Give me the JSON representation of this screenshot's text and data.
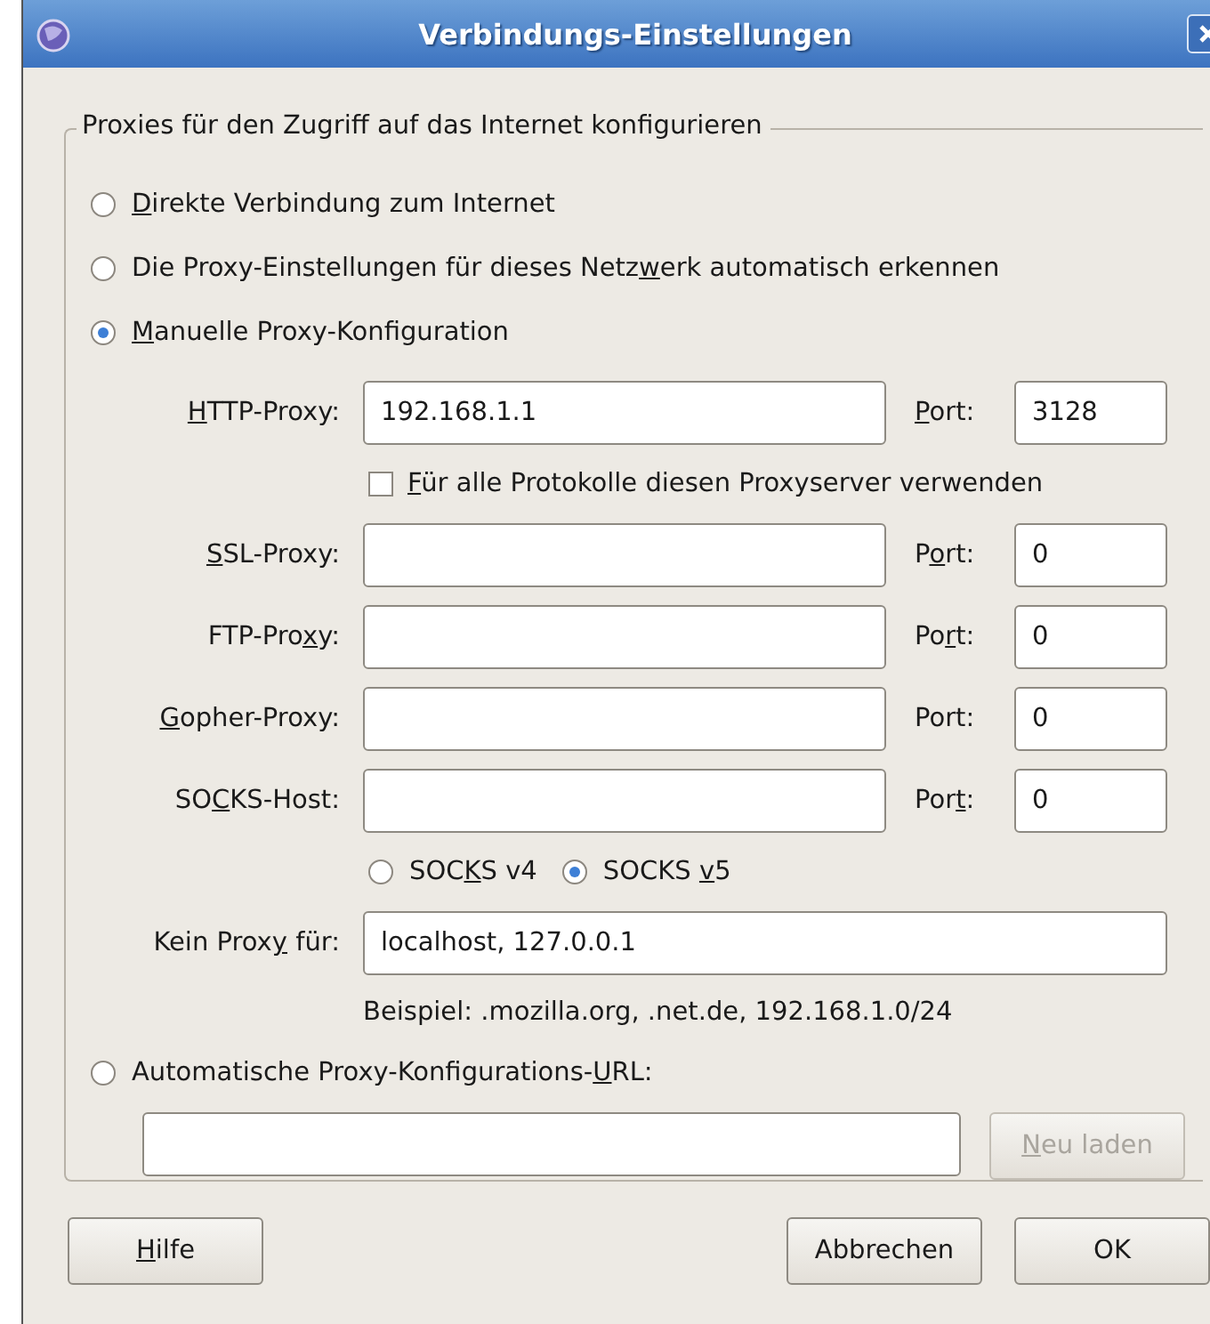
{
  "window": {
    "title": "Verbindungs-Einstellungen"
  },
  "group": {
    "legend": "Proxies für den Zugriff auf das Internet konfigurieren"
  },
  "modes": [
    {
      "label": {
        "key": "D",
        "post": "irekte Verbindung zum Internet"
      },
      "selected": false
    },
    {
      "label": {
        "pre": "Die Proxy-Einstellungen für dieses Netz",
        "key": "w",
        "post": "erk automatisch erkennen"
      },
      "selected": false
    },
    {
      "label": {
        "key": "M",
        "post": "anuelle Proxy-Konfiguration"
      },
      "selected": true
    }
  ],
  "http": {
    "label": {
      "key": "H",
      "post": "TTP-Proxy:"
    },
    "host": "192.168.1.1",
    "port_label": {
      "key": "P",
      "post": "ort:"
    },
    "port": "3128"
  },
  "use_for_all": {
    "label": {
      "key": "F",
      "post": "ür alle Protokolle diesen Proxyserver verwenden"
    },
    "checked": false
  },
  "proxies": [
    {
      "label": {
        "key": "S",
        "post": "SL-Proxy:"
      },
      "port_label": {
        "pre": "P",
        "key": "o",
        "post": "rt:"
      },
      "port": "0"
    },
    {
      "label": {
        "pre": "FTP-Pro",
        "key": "x",
        "post": "y:"
      },
      "port_label": {
        "pre": "Po",
        "key": "r",
        "post": "t:"
      },
      "port": "0"
    },
    {
      "label": {
        "key": "G",
        "post": "opher-Proxy:"
      },
      "port_label": {
        "pre": "Port:"
      },
      "port": "0"
    },
    {
      "label": {
        "pre": "SO",
        "key": "C",
        "post": "KS-Host:"
      },
      "port_label": {
        "pre": "Por",
        "key": "t",
        "post": ":"
      },
      "port": "0"
    }
  ],
  "socks_versions": [
    {
      "label": {
        "pre": "SOC",
        "key": "K",
        "post": "S v4"
      },
      "selected": false
    },
    {
      "label": {
        "pre": "SOCKS ",
        "key": "v",
        "post": "5"
      },
      "selected": true
    }
  ],
  "no_proxy": {
    "label": {
      "pre": "Kein Prox",
      "key": "y",
      "post": " für:"
    },
    "value": "localhost, 127.0.0.1"
  },
  "example": "Beispiel: .mozilla.org, .net.de, 192.168.1.0/24",
  "auto_config": {
    "label": {
      "pre": "Automatische Proxy-Konfigurations-",
      "key": "U",
      "post": "RL:"
    },
    "selected": false,
    "reload_button": {
      "label": {
        "key": "N",
        "post": "eu laden"
      },
      "disabled": true
    }
  },
  "buttons": [
    {
      "label": {
        "key": "H",
        "post": "ilfe"
      }
    },
    {
      "label": {
        "pre": "Abbrechen"
      }
    },
    {
      "label": {
        "pre": "OK"
      }
    }
  ]
}
